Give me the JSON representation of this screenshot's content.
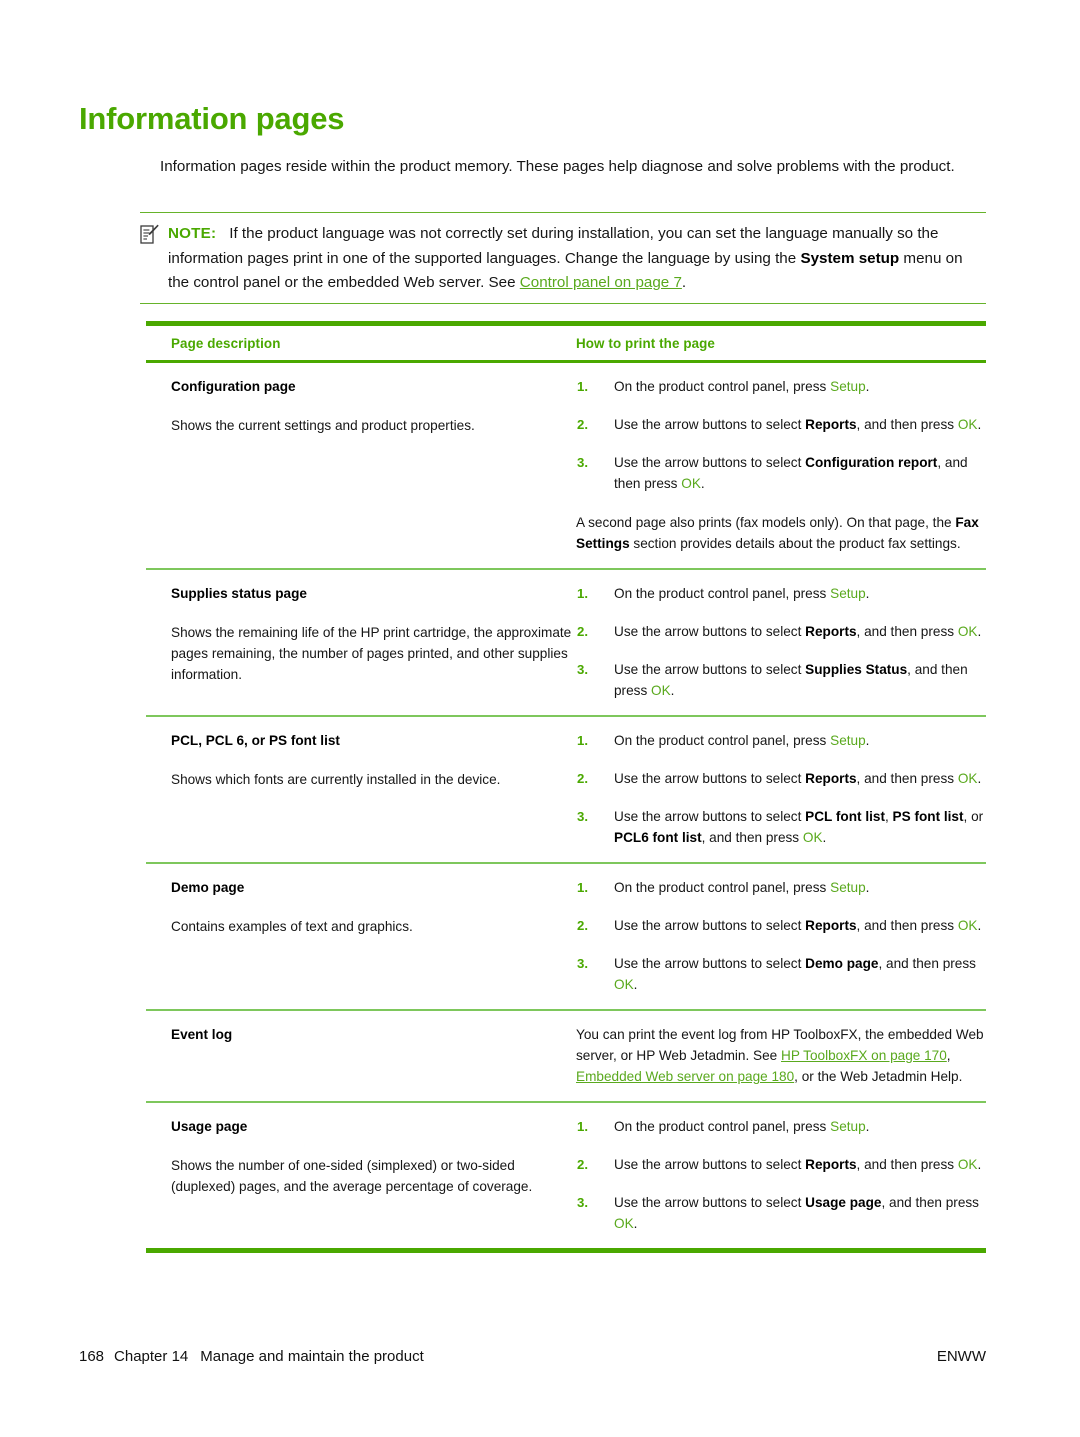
{
  "document": {
    "title": "Information pages",
    "title_color": "#4aa800",
    "accent_color": "#4aa800",
    "rule_color": "#7ec75c",
    "link_color": "#5aa91e"
  },
  "intro": {
    "text": "Information pages reside within the product memory. These pages help diagnose and solve problems with the product."
  },
  "note": {
    "icon": "note-pencil-icon",
    "label": "NOTE:",
    "text_1": "If the product language was not correctly set during installation, you can set the language manually so the information pages print in one of the supported languages. Change the language by using the ",
    "bold_1": "System setup",
    "text_2": " menu on the control panel or the embedded Web server. See ",
    "link_1": "Control panel on page 7",
    "text_3": "."
  },
  "table": {
    "headers": {
      "col1": "Page description",
      "col2": "How to print the page"
    },
    "rows": [
      {
        "title": "Configuration page",
        "description": "Shows the current settings and product properties.",
        "steps": [
          {
            "num": "1.",
            "t1": "On the product control panel, press ",
            "kw1": "Setup",
            "t2": "."
          },
          {
            "num": "2.",
            "t1": "Use the arrow buttons to select ",
            "b1": "Reports",
            "t2": ", and then press ",
            "kw1": "OK",
            "t3": "."
          },
          {
            "num": "3.",
            "t1": "Use the arrow buttons to select ",
            "b1": "Configuration report",
            "t2": ", and then press ",
            "kw1": "OK",
            "t3": "."
          }
        ],
        "note_t1": "A second page also prints (fax models only). On that page, the ",
        "note_b1": "Fax Settings",
        "note_t2": " section provides details about the product fax settings."
      },
      {
        "title": "Supplies status page",
        "description": "Shows the remaining life of the HP print cartridge, the approximate pages remaining, the number of pages printed, and other supplies information.",
        "steps": [
          {
            "num": "1.",
            "t1": "On the product control panel, press ",
            "kw1": "Setup",
            "t2": "."
          },
          {
            "num": "2.",
            "t1": "Use the arrow buttons to select ",
            "b1": "Reports",
            "t2": ", and then press ",
            "kw1": "OK",
            "t3": "."
          },
          {
            "num": "3.",
            "t1": "Use the arrow buttons to select ",
            "b1": "Supplies Status",
            "t2": ", and then press ",
            "kw1": "OK",
            "t3": "."
          }
        ]
      },
      {
        "title": "PCL, PCL 6, or PS font list",
        "description": "Shows which fonts are currently installed in the device.",
        "steps": [
          {
            "num": "1.",
            "t1": "On the product control panel, press ",
            "kw1": "Setup",
            "t2": "."
          },
          {
            "num": "2.",
            "t1": "Use the arrow buttons to select ",
            "b1": "Reports",
            "t2": ", and then press ",
            "kw1": "OK",
            "t3": "."
          },
          {
            "num": "3.",
            "t1": "Use the arrow buttons to select ",
            "b1": "PCL font list",
            "t2": ", ",
            "b2": "PS font list",
            "t3": ", or ",
            "b3": "PCL6 font list",
            "t4": ", and then press ",
            "kw1": "OK",
            "t5": "."
          }
        ]
      },
      {
        "title": "Demo page",
        "description": "Contains examples of text and graphics.",
        "steps": [
          {
            "num": "1.",
            "t1": "On the product control panel, press ",
            "kw1": "Setup",
            "t2": "."
          },
          {
            "num": "2.",
            "t1": "Use the arrow buttons to select ",
            "b1": "Reports",
            "t2": ", and then press ",
            "kw1": "OK",
            "t3": "."
          },
          {
            "num": "3.",
            "t1": "Use the arrow buttons to select ",
            "b1": "Demo page",
            "t2": ", and then press ",
            "kw1": "OK",
            "t3": "."
          }
        ]
      },
      {
        "title": "Event log",
        "description": "",
        "plain_t1": "You can print the event log from HP ToolboxFX, the embedded Web server, or HP Web Jetadmin. See ",
        "plain_link1": "HP ToolboxFX on page 170",
        "plain_t2": ", ",
        "plain_link2": "Embedded Web server on page 180",
        "plain_t3": ", or the Web Jetadmin Help."
      },
      {
        "title": "Usage page",
        "description": "Shows the number of one-sided (simplexed) or two-sided (duplexed) pages, and the average percentage of coverage.",
        "steps": [
          {
            "num": "1.",
            "t1": "On the product control panel, press ",
            "kw1": "Setup",
            "t2": "."
          },
          {
            "num": "2.",
            "t1": "Use the arrow buttons to select ",
            "b1": "Reports",
            "t2": ", and then press ",
            "kw1": "OK",
            "t3": "."
          },
          {
            "num": "3.",
            "t1": "Use the arrow buttons to select ",
            "b1": "Usage page",
            "t2": ", and then press ",
            "kw1": "OK",
            "t3": "."
          }
        ]
      }
    ]
  },
  "footer": {
    "page_number": "168",
    "chapter": "Chapter 14",
    "chapter_title": "Manage and maintain the product",
    "right": "ENWW"
  }
}
